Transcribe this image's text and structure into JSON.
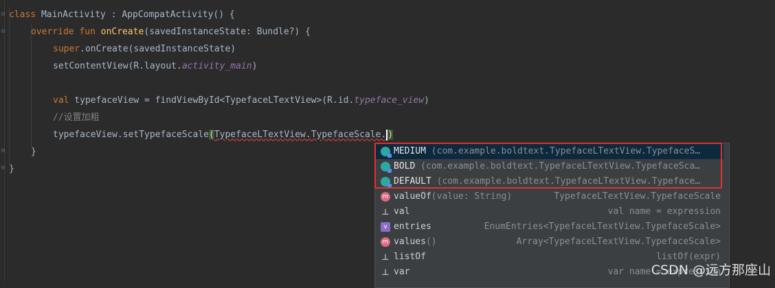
{
  "code": {
    "line1": {
      "kw": "class",
      "rest": " MainActivity : AppCompatActivity() {"
    },
    "line2": {
      "kw": "override fun",
      "fn": "onCreate",
      "rest": "(savedInstanceState: Bundle?) {"
    },
    "line3": {
      "kw": "super",
      "rest": ".onCreate(savedInstanceState)"
    },
    "line4": {
      "pre": "setContentView(R.layout.",
      "it": "activity_main",
      "post": ")"
    },
    "line6": {
      "kw": "val",
      "pre": " typefaceView = findViewById<TypefaceLTextView>(R.id.",
      "it": "typeface_view",
      "post": ")"
    },
    "line7": {
      "comment": "//设置加粗"
    },
    "line8": {
      "pre": "typefaceView.setTypefaceScale",
      "paren": "(",
      "mid": "TypefaceLTextView.TypefaceScale.",
      "close": ")"
    },
    "line9": {
      "text": "}"
    },
    "line10": {
      "text": "}"
    }
  },
  "completion": {
    "items": [
      {
        "icon": "enum-constant-icon",
        "name": "MEDIUM",
        "sig": " (com.example.boldtext.TypefaceLTextView.TypefaceS…",
        "detail": ""
      },
      {
        "icon": "enum-constant-icon",
        "name": "BOLD",
        "sig": " (com.example.boldtext.TypefaceLTextView.TypefaceSca…",
        "detail": ""
      },
      {
        "icon": "enum-constant-icon",
        "name": "DEFAULT",
        "sig": " (com.example.boldtext.TypefaceLTextView.Typeface…",
        "detail": ""
      },
      {
        "icon": "method-icon",
        "name": "valueOf",
        "sig": "(value: String)",
        "detail": "TypefaceLTextView.TypefaceScale"
      },
      {
        "icon": "live-template-icon",
        "name": "val",
        "sig": "",
        "detail": "val name = expression"
      },
      {
        "icon": "variable-icon",
        "name": "entries",
        "sig": "",
        "detail": "EnumEntries<TypefaceLTextView.TypefaceScale>"
      },
      {
        "icon": "method-icon",
        "name": "values",
        "sig": "()",
        "detail": "Array<TypefaceLTextView.TypefaceScale>"
      },
      {
        "icon": "live-template-icon",
        "name": "listOf",
        "sig": "",
        "detail": "listOf(expr)"
      },
      {
        "icon": "live-template-icon",
        "name": "var",
        "sig": "",
        "detail": "var name = expression"
      }
    ],
    "icon_glyphs": {
      "method": "m",
      "variable": "v",
      "template": "⊥"
    }
  },
  "watermark": "CSDN @远方那座山",
  "colors": {
    "background": "#2b2b2b",
    "keyword": "#cc7832",
    "function": "#ffc66d",
    "field": "#9876aa",
    "highlight_box": "#e0322f"
  }
}
